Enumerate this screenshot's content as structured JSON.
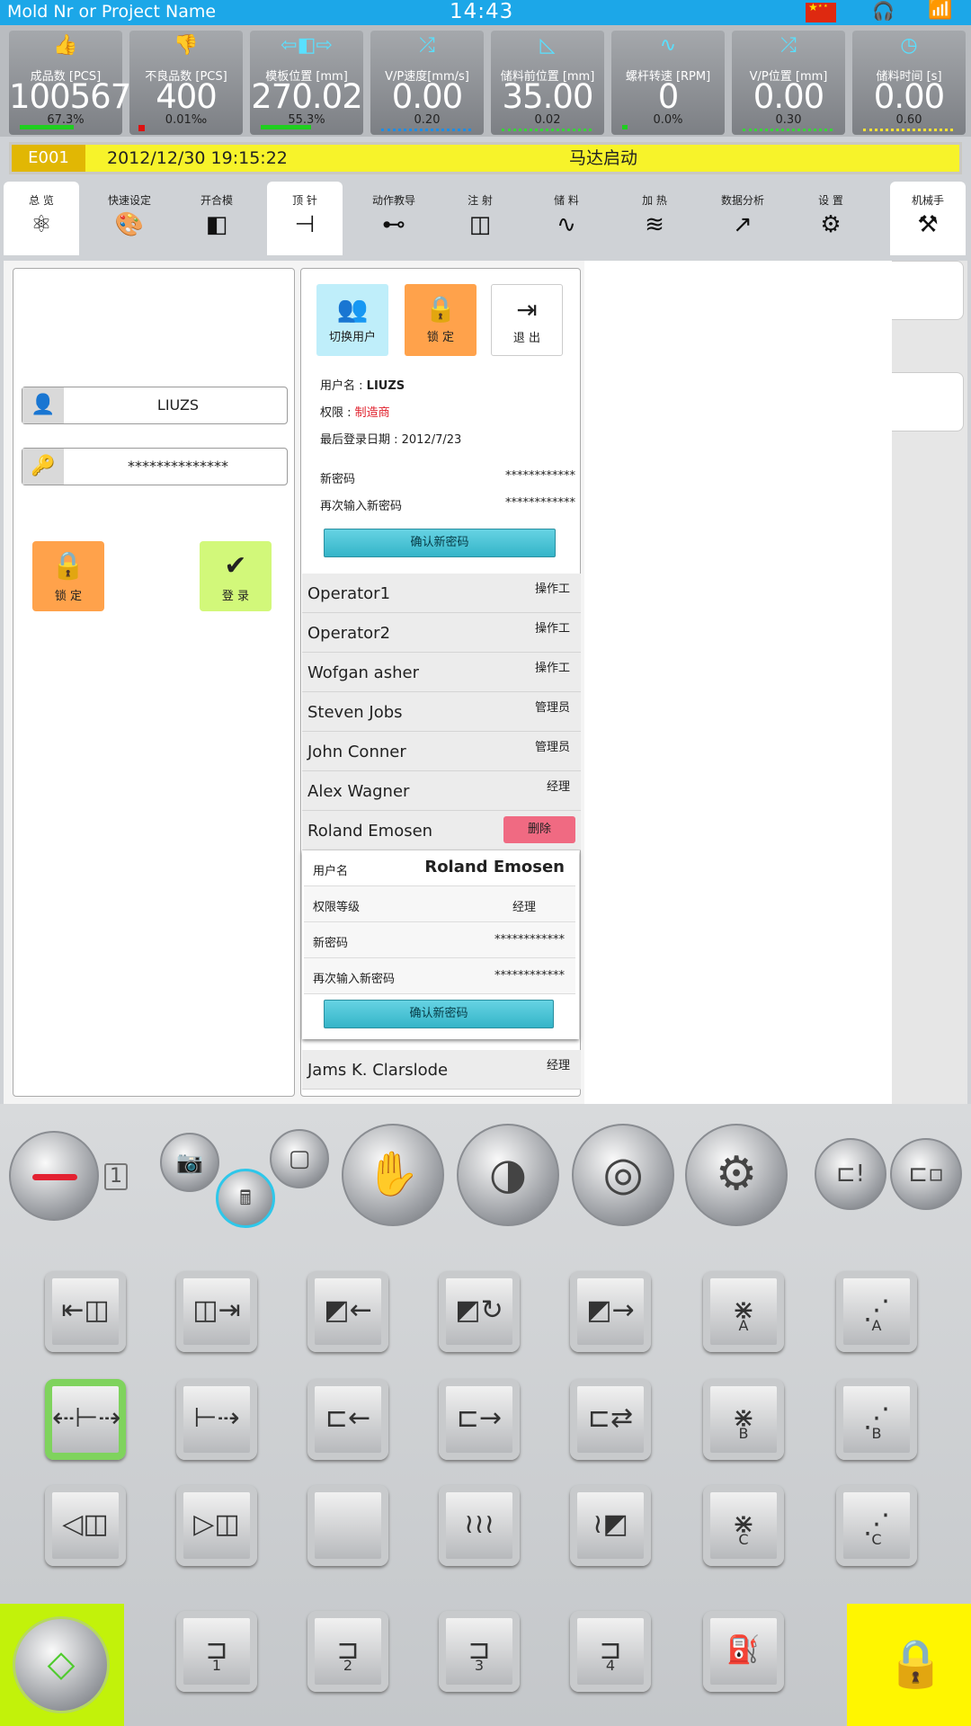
{
  "topbar": {
    "title": "Mold Nr or Project Name",
    "time": "14:43"
  },
  "metrics": [
    {
      "label": "成品数 [PCS]",
      "value": "100567",
      "sub": "67.3%",
      "icon": "thumbs-up-icon",
      "glyph": "👍"
    },
    {
      "label": "不良品数 [PCS]",
      "value": "400",
      "sub": "0.01‰",
      "icon": "thumbs-down-icon",
      "glyph": "👎"
    },
    {
      "label": "模板位置 [mm]",
      "value": "270.02",
      "sub": "55.3%",
      "icon": "mold-position-icon",
      "glyph": "⇦◧⇨"
    },
    {
      "label": "V/P速度[mm/s]",
      "value": "0.00",
      "sub": "0.20",
      "icon": "vp-speed-icon",
      "glyph": "⤮"
    },
    {
      "label": "储料前位置 [mm]",
      "value": "35.00",
      "sub": "0.02",
      "icon": "charge-position-icon",
      "glyph": "◺"
    },
    {
      "label": "螺杆转速 [RPM]",
      "value": "0",
      "sub": "0.0%",
      "icon": "screw-speed-icon",
      "glyph": "∿"
    },
    {
      "label": "V/P位置 [mm]",
      "value": "0.00",
      "sub": "0.30",
      "icon": "vp-position-icon",
      "glyph": "⤮"
    },
    {
      "label": "储料时间 [s]",
      "value": "0.00",
      "sub": "0.60",
      "icon": "clock-icon",
      "glyph": "◷"
    }
  ],
  "alarm": {
    "code": "E001",
    "datetime": "2012/12/30 19:15:22",
    "message": "马达启动"
  },
  "tabs": [
    {
      "label": "总 览",
      "glyph": "⚛"
    },
    {
      "label": "快速设定",
      "glyph": "🎨"
    },
    {
      "label": "开合模",
      "glyph": "◧"
    },
    {
      "label": "顶 针",
      "glyph": "⊣"
    },
    {
      "label": "动作教导",
      "glyph": "⊷"
    },
    {
      "label": "注 射",
      "glyph": "◫"
    },
    {
      "label": "储 料",
      "glyph": "∿"
    },
    {
      "label": "加 热",
      "glyph": "≋"
    },
    {
      "label": "数据分析",
      "glyph": "↗"
    },
    {
      "label": "设 置",
      "glyph": "⚙"
    },
    {
      "label": "机械手",
      "glyph": "⚒"
    }
  ],
  "login": {
    "username": "LIUZS",
    "password": "**************",
    "lock_label": "锁 定",
    "login_label": "登 录"
  },
  "user_panel": {
    "switch_user": "切换用户",
    "lock": "锁 定",
    "logout": "退 出",
    "username_label": "用户名 : ",
    "username_value": "LIUZS",
    "permission_label": "权限 : ",
    "permission_value": "制造商",
    "last_login": "最后登录日期 : 2012/7/23",
    "new_password_label": "新密码",
    "new_password_value": "************",
    "repeat_password_label": "再次输入新密码",
    "repeat_password_value": "************",
    "confirm_label": "确认新密码"
  },
  "users": [
    {
      "name": "Operator1",
      "role": "操作工"
    },
    {
      "name": "Operator2",
      "role": "操作工"
    },
    {
      "name": "Wofgan asher",
      "role": "操作工"
    },
    {
      "name": "Steven Jobs",
      "role": "管理员"
    },
    {
      "name": "John Conner",
      "role": "管理员"
    },
    {
      "name": "Alex Wagner",
      "role": "经理"
    },
    {
      "name": "Roland Emosen",
      "role": "删除"
    }
  ],
  "user_detail": {
    "username_label": "用户名",
    "username_value": "Roland Emosen",
    "level_label": "权限等级",
    "level_value": "经理",
    "new_password_label": "新密码",
    "new_password_value": "************",
    "repeat_password_label": "再次输入新密码",
    "repeat_password_value": "************",
    "confirm_label": "确认新密码"
  },
  "last_user": {
    "name": "Jams K. Clarslode",
    "role": "经理"
  },
  "machine": {
    "mode_number": "1"
  },
  "keys": [
    {
      "glyph": "⇤◫",
      "sub": ""
    },
    {
      "glyph": "◫⇥",
      "sub": ""
    },
    {
      "glyph": "◩←",
      "sub": ""
    },
    {
      "glyph": "◩↻",
      "sub": ""
    },
    {
      "glyph": "◩→",
      "sub": ""
    },
    {
      "glyph": "⋇",
      "sub": "A"
    },
    {
      "glyph": "⋰",
      "sub": "A"
    },
    {
      "glyph": "⇠⊢⇢",
      "sub": ""
    },
    {
      "glyph": "⊢⇢",
      "sub": ""
    },
    {
      "glyph": "⊏←",
      "sub": ""
    },
    {
      "glyph": "⊏→",
      "sub": ""
    },
    {
      "glyph": "⊏⇄",
      "sub": ""
    },
    {
      "glyph": "⋇",
      "sub": "B"
    },
    {
      "glyph": "⋰",
      "sub": "B"
    },
    {
      "glyph": "◁◫",
      "sub": ""
    },
    {
      "glyph": "▷◫",
      "sub": ""
    },
    {
      "glyph": "",
      "sub": ""
    },
    {
      "glyph": "≀≀≀",
      "sub": ""
    },
    {
      "glyph": "≀◩",
      "sub": ""
    },
    {
      "glyph": "⋇",
      "sub": "C"
    },
    {
      "glyph": "⋰",
      "sub": "C"
    },
    {
      "glyph": "⊐",
      "sub": "1"
    },
    {
      "glyph": "⊐",
      "sub": "2"
    },
    {
      "glyph": "⊐",
      "sub": "3"
    },
    {
      "glyph": "⊐",
      "sub": "4"
    },
    {
      "glyph": "⛽",
      "sub": ""
    }
  ],
  "colors": {
    "topbar": "#1ca7e8",
    "alarm": "#f7f32a",
    "alarm_code": "#e1b704",
    "accent_green": "#c2f20a",
    "lock_yellow": "#fff600",
    "permission_red": "#e0202c"
  }
}
